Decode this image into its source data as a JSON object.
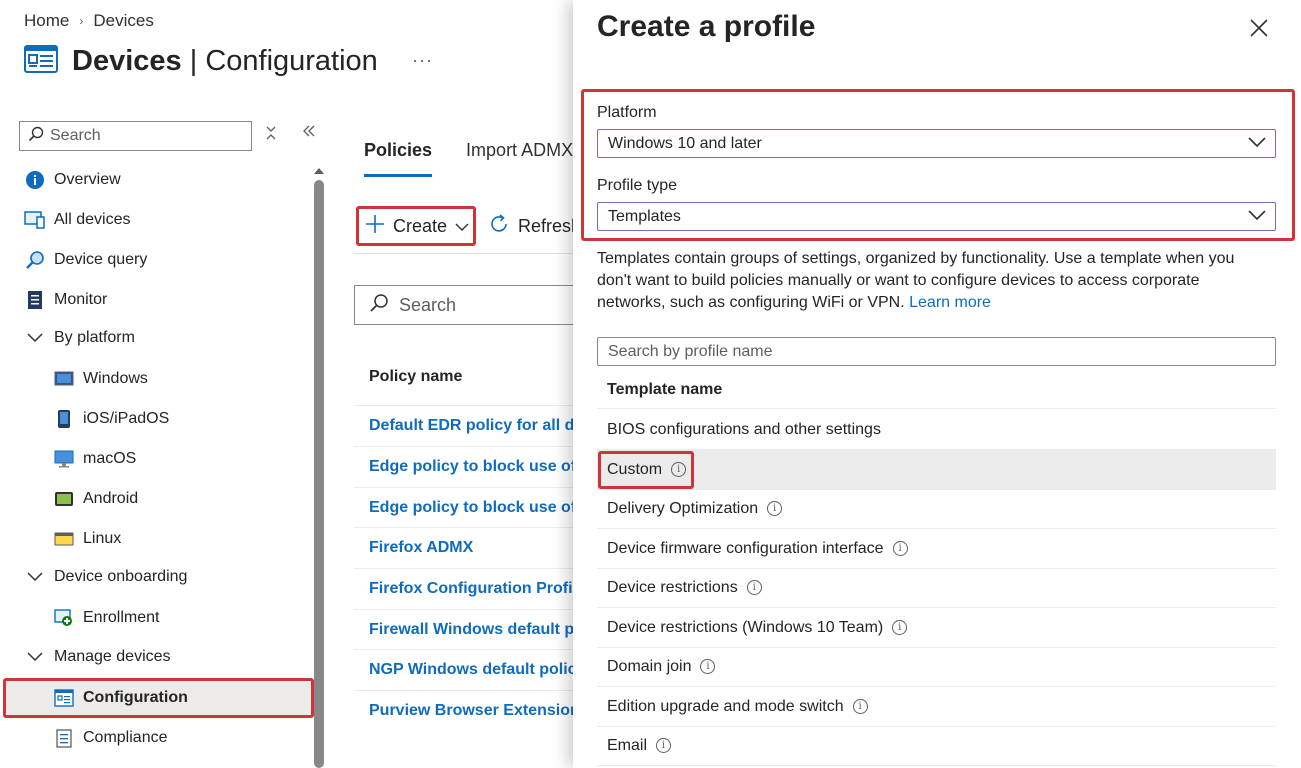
{
  "breadcrumb": {
    "home": "Home",
    "sep": "›",
    "current": "Devices"
  },
  "page": {
    "title_bold": "Devices",
    "title_sep": " | ",
    "title_rest": "Configuration",
    "more": "···"
  },
  "left_search": {
    "placeholder": "Search"
  },
  "nav": {
    "items": [
      {
        "label": "Overview",
        "icon": "info-icon"
      },
      {
        "label": "All devices",
        "icon": "devices-icon"
      },
      {
        "label": "Device query",
        "icon": "query-icon"
      },
      {
        "label": "Monitor",
        "icon": "monitor-icon"
      },
      {
        "label": "By platform",
        "icon": "chevron-down-icon"
      },
      {
        "label": "Windows",
        "icon": "windows-device-icon"
      },
      {
        "label": "iOS/iPadOS",
        "icon": "phone-icon"
      },
      {
        "label": "macOS",
        "icon": "mac-icon"
      },
      {
        "label": "Android",
        "icon": "android-icon"
      },
      {
        "label": "Linux",
        "icon": "linux-icon"
      },
      {
        "label": "Device onboarding",
        "icon": "chevron-down-icon"
      },
      {
        "label": "Enrollment",
        "icon": "enrollment-icon"
      },
      {
        "label": "Manage devices",
        "icon": "chevron-down-icon"
      },
      {
        "label": "Configuration",
        "icon": "configuration-icon",
        "selected": true
      },
      {
        "label": "Compliance",
        "icon": "compliance-icon"
      }
    ]
  },
  "tabs": [
    {
      "label": "Policies",
      "active": true
    },
    {
      "label": "Import ADMX",
      "active": false
    }
  ],
  "toolbar": {
    "create": "Create",
    "refresh": "Refresh"
  },
  "mid_search": {
    "placeholder": "Search"
  },
  "policies": {
    "header": "Policy name",
    "rows": [
      "Default EDR policy for all devices",
      "Edge policy to block use of",
      "Edge policy to block use of",
      "Firefox ADMX",
      "Firefox Configuration Profile",
      "Firewall Windows default policy",
      "NGP Windows default policy",
      "Purview Browser Extension"
    ]
  },
  "blade": {
    "title": "Create a profile",
    "platform_label": "Platform",
    "platform_value": "Windows 10 and later",
    "profile_type_label": "Profile type",
    "profile_type_value": "Templates",
    "description": "Templates contain groups of settings, organized by functionality. Use a template when you don't want to build policies manually or want to configure devices to access corporate networks, such as configuring WiFi or VPN.",
    "learn_more": "Learn more",
    "search_placeholder": "Search by profile name",
    "template_header": "Template name",
    "templates": [
      {
        "name": "BIOS configurations and other settings",
        "info": false
      },
      {
        "name": "Custom",
        "info": true,
        "highlighted": true
      },
      {
        "name": "Delivery Optimization",
        "info": true
      },
      {
        "name": "Device firmware configuration interface",
        "info": true
      },
      {
        "name": "Device restrictions",
        "info": true
      },
      {
        "name": "Device restrictions (Windows 10 Team)",
        "info": true
      },
      {
        "name": "Domain join",
        "info": true
      },
      {
        "name": "Edition upgrade and mode switch",
        "info": true
      },
      {
        "name": "Email",
        "info": true
      }
    ]
  },
  "colors": {
    "accent": "#0f6cbd",
    "highlight": "#d13438",
    "dropdown_border": "#8764b8"
  }
}
